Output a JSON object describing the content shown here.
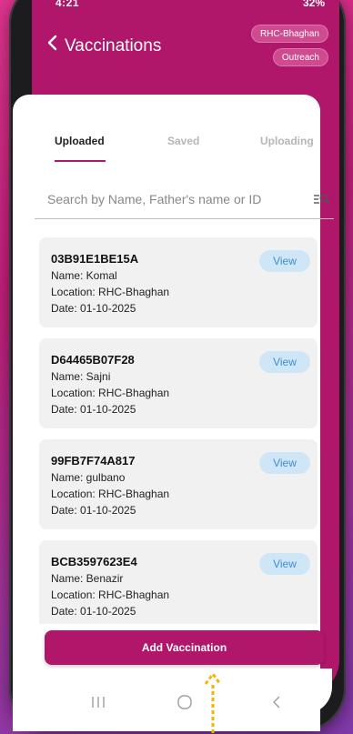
{
  "status": {
    "time": "4:21",
    "battery": "32%"
  },
  "header": {
    "title": "Vaccinations",
    "location_pill": "RHC-Bhaghan",
    "mode_pill": "Outreach"
  },
  "tabs": [
    {
      "label": "Uploaded",
      "active": true
    },
    {
      "label": "Saved",
      "active": false
    },
    {
      "label": "Uploading",
      "active": false
    }
  ],
  "search": {
    "placeholder": "Search by Name, Father's name or ID",
    "value": ""
  },
  "records": [
    {
      "id": "03B91E1BE15A",
      "name": "Name: Komal",
      "location": "Location: RHC-Bhaghan",
      "date": "Date: 01-10-2025",
      "action": "View"
    },
    {
      "id": "D64465B07F28",
      "name": "Name: Sajni",
      "location": "Location: RHC-Bhaghan",
      "date": "Date: 01-10-2025",
      "action": "View"
    },
    {
      "id": "99FB7F74A817",
      "name": "Name: gulbano",
      "location": "Location: RHC-Bhaghan",
      "date": "Date: 01-10-2025",
      "action": "View"
    },
    {
      "id": "BCB3597623E4",
      "name": "Name: Benazir",
      "location": "Location: RHC-Bhaghan",
      "date": "Date: 01-10-2025",
      "action": "View"
    }
  ],
  "add_button_label": "Add Vaccination",
  "colors": {
    "brand": "#b0166a",
    "view_bg": "#cfe6f6",
    "view_text": "#3d8fd0",
    "annotation_arrow": "#f4b400"
  },
  "icons": {
    "back": "chevron-left-icon",
    "search": "search-filter-icon",
    "nav_recents": "recents-icon",
    "nav_home": "home-icon",
    "nav_back": "back-arrow-icon",
    "annotation": "arrow-up-annotation-icon"
  }
}
